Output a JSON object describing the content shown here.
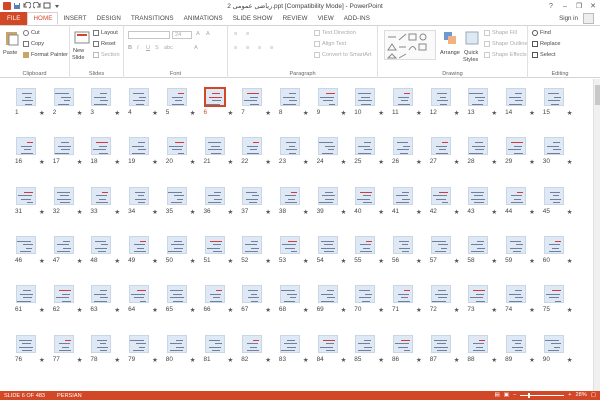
{
  "window": {
    "title": "2 ریاضی عمومی.ppt [Compatibility Mode] - PowerPoint",
    "signin": "Sign in",
    "controls": [
      "?",
      "–",
      "❐",
      "✕"
    ]
  },
  "tabs": [
    {
      "label": "FILE"
    },
    {
      "label": "HOME"
    },
    {
      "label": "INSERT"
    },
    {
      "label": "DESIGN"
    },
    {
      "label": "TRANSITIONS"
    },
    {
      "label": "ANIMATIONS"
    },
    {
      "label": "SLIDE SHOW"
    },
    {
      "label": "REVIEW"
    },
    {
      "label": "VIEW"
    },
    {
      "label": "ADD-INS"
    }
  ],
  "ribbon": {
    "clipboard": {
      "label": "Clipboard",
      "paste": "Paste",
      "cut": "Cut",
      "copy": "Copy",
      "format_painter": "Format Painter"
    },
    "slides": {
      "label": "Slides",
      "new_slide": "New",
      "new_slide2": "Slide",
      "layout": "Layout",
      "reset": "Reset",
      "section": "Section"
    },
    "font": {
      "label": "Font",
      "size": "24"
    },
    "paragraph": {
      "label": "Paragraph",
      "text_direction": "Text Direction",
      "align_text": "Align Text",
      "convert": "Convert to SmartArt"
    },
    "drawing": {
      "label": "Drawing",
      "arrange": "Arrange",
      "quick": "Quick",
      "styles": "Styles",
      "shape_fill": "Shape Fill",
      "shape_outline": "Shape Outline",
      "shape_effects": "Shape Effects"
    },
    "editing": {
      "label": "Editing",
      "find": "Find",
      "replace": "Replace",
      "select": "Select"
    }
  },
  "sorter": {
    "selected_slide": 6,
    "star": "★",
    "first_visible": 1,
    "last_visible": 90,
    "columns": 15,
    "rows_visible": 6
  },
  "statusbar": {
    "slide_info": "SLIDE 6 OF 483",
    "language": "PERSIAN",
    "zoom": "28%",
    "zoom_minus": "–",
    "zoom_plus": "+"
  },
  "colors": {
    "accent": "#d24726",
    "thumb_bg": "#dfe9f5"
  }
}
